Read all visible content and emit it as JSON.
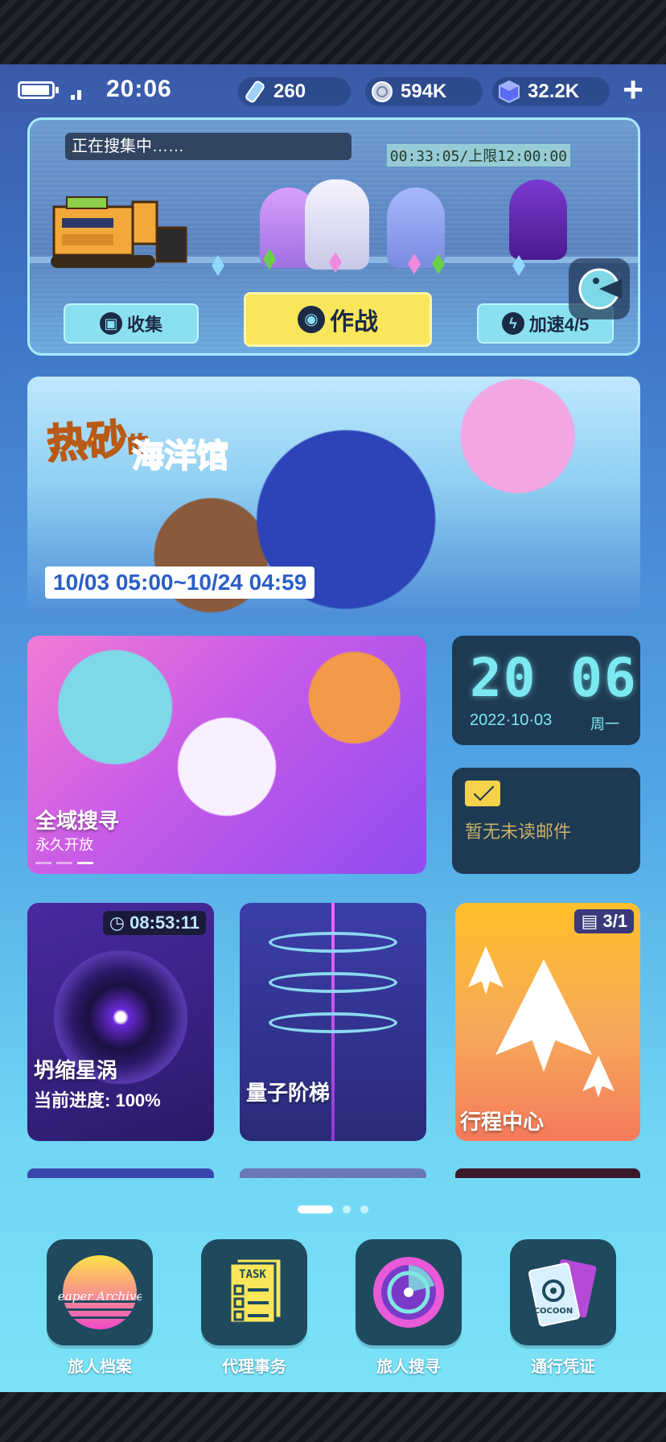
{
  "status": {
    "time": "20:06",
    "resources": [
      {
        "icon": "stamina-crystal-icon",
        "value": "260"
      },
      {
        "icon": "coin-icon",
        "value": "594K"
      },
      {
        "icon": "gem-cube-icon",
        "value": "32.2K"
      }
    ],
    "plus_label": "+"
  },
  "gather": {
    "status_text": "正在搜集中……",
    "timer": "00:33:05/上限12:00:00",
    "collect_label": "收集",
    "battle_label": "作战",
    "speed_label": "加速4/5"
  },
  "banner": {
    "title_part1": "热砂",
    "title_part2": "的",
    "title_part3": "海洋馆",
    "date_range": "10/03 05:00~10/24 04:59"
  },
  "search_tile": {
    "title": "全域搜寻",
    "subtitle": "永久开放"
  },
  "clock_tile": {
    "time": "20 06",
    "date": "2022·10·03",
    "weekday": "周一"
  },
  "mail_tile": {
    "text": "暂无未读邮件"
  },
  "vortex_tile": {
    "timer": "08:53:11",
    "title": "坍缩星涡",
    "progress_label": "当前进度:",
    "progress_value": "100%"
  },
  "quantum_tile": {
    "title": "量子阶梯"
  },
  "travel_tile": {
    "ticket": "3/1",
    "title": "行程中心"
  },
  "dock": [
    {
      "label": "旅人档案",
      "icon": "leaper-archives-icon",
      "icon_text": "Leaper Archives"
    },
    {
      "label": "代理事务",
      "icon": "task-list-icon",
      "icon_text": "TASK"
    },
    {
      "label": "旅人搜寻",
      "icon": "radar-icon"
    },
    {
      "label": "通行凭证",
      "icon": "pass-card-icon",
      "icon_text": "COCOON"
    }
  ],
  "colors": {
    "accent_yellow": "#f9e65a",
    "accent_cyan": "#7ce9f2",
    "tile_dark": "#1e3a52"
  }
}
